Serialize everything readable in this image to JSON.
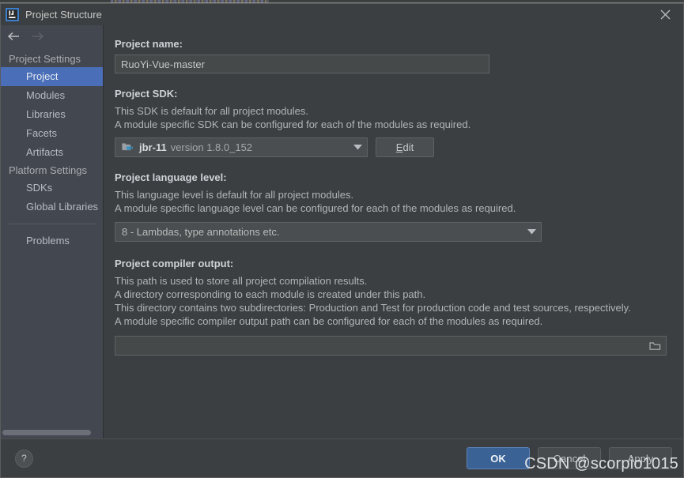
{
  "window": {
    "title": "Project Structure",
    "app_icon": "intellij-idea-icon",
    "close_label": "✕"
  },
  "sidebar": {
    "back_arrow": "back-arrow-icon",
    "forward_arrow": "forward-arrow-icon",
    "groups": [
      {
        "label": "Project Settings",
        "items": [
          {
            "label": "Project",
            "selected": true
          },
          {
            "label": "Modules",
            "selected": false
          },
          {
            "label": "Libraries",
            "selected": false
          },
          {
            "label": "Facets",
            "selected": false
          },
          {
            "label": "Artifacts",
            "selected": false
          }
        ]
      },
      {
        "label": "Platform Settings",
        "items": [
          {
            "label": "SDKs",
            "selected": false
          },
          {
            "label": "Global Libraries",
            "selected": false
          }
        ]
      }
    ],
    "problems": {
      "label": "Problems",
      "selected": false
    }
  },
  "main": {
    "project_name": {
      "title": "Project name:",
      "value": "RuoYi-Vue-master",
      "placeholder": ""
    },
    "project_sdk": {
      "title": "Project SDK:",
      "description": [
        "This SDK is default for all project modules.",
        "A module specific SDK can be configured for each of the modules as required."
      ],
      "sdk_icon": "java-sdk-folder-icon",
      "sdk_name": "jbr-11",
      "sdk_version": "version 1.8.0_152",
      "edit_label": "Edit",
      "edit_mnemonic": "E",
      "edit_rest": "dit"
    },
    "language_level": {
      "title": "Project language level:",
      "description": [
        "This language level is default for all project modules.",
        "A module specific language level can be configured for each of the modules as required."
      ],
      "value": "8 - Lambdas, type annotations etc."
    },
    "compiler_output": {
      "title": "Project compiler output:",
      "description": [
        "This path is used to store all project compilation results.",
        "A directory corresponding to each module is created under this path.",
        "This directory contains two subdirectories: Production and Test for production code and test sources, respectively.",
        "A module specific compiler output path can be configured for each of the modules as required."
      ],
      "value": "",
      "placeholder": "",
      "browse_icon": "folder-browse-icon"
    }
  },
  "footer": {
    "help_label": "?",
    "ok_label": "OK",
    "cancel_label": "Cancel",
    "apply_label": "Apply"
  },
  "watermark": {
    "text": "CSDN @scorpio1015"
  },
  "colors": {
    "accent_selection": "#4a6fb8",
    "ok_button": "#3a6295",
    "dialog_bg": "#3c3f41",
    "sidebar_bg": "#434750"
  }
}
